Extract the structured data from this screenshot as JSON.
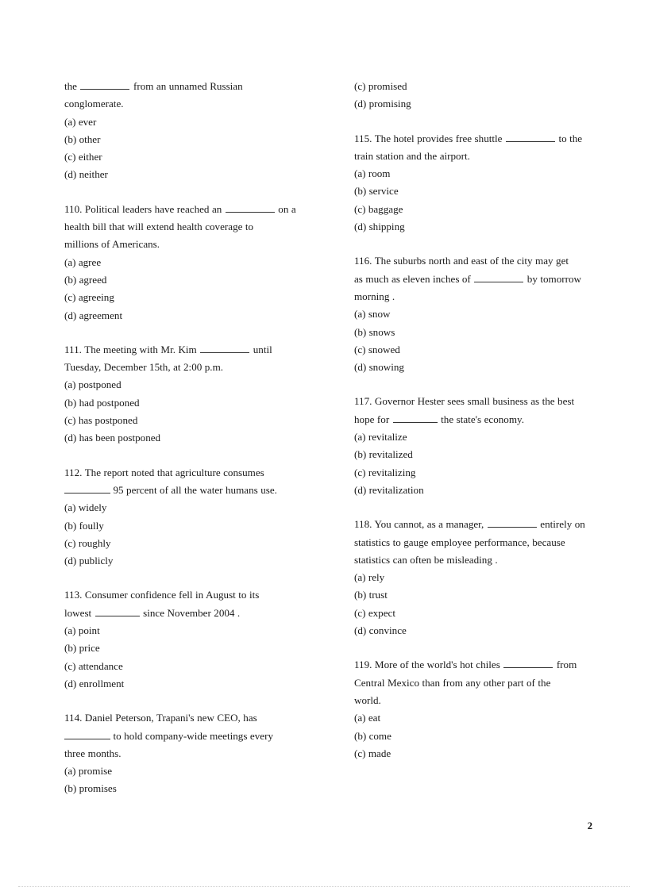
{
  "document": {
    "page_number": "2",
    "type": "multiple-choice grammar test",
    "columns": 2
  },
  "left_column": {
    "questions": [
      {
        "number": "",
        "stem_parts": {
          "before": "the",
          "blank": true,
          "after": "from an unnamed Russian conglomerate."
        },
        "stem_line1": "the",
        "stem_line1_tail": "from    an    unnamed    Russian",
        "stem_line2": "conglomerate.",
        "options": [
          {
            "label": "(a)",
            "text": "ever"
          },
          {
            "label": "(b)",
            "text": "other"
          },
          {
            "label": "(c)",
            "text": "either"
          },
          {
            "label": "(d)",
            "text": "neither"
          }
        ]
      },
      {
        "number": "110.",
        "stem_line1": "Political  leaders have reached an",
        "stem_line1_tail": "on a",
        "stem_line2": "health   bill   that   will   extend  health  coverage  to",
        "stem_line3": "millions  of Americans.",
        "options": [
          {
            "label": "(a)",
            "text": "agree"
          },
          {
            "label": "(b)",
            "text": "agreed"
          },
          {
            "label": "(c)",
            "text": "agreeing"
          },
          {
            "label": "(d)",
            "text": "agreement"
          }
        ]
      },
      {
        "number": "111.",
        "stem_line1": "The   meeting   with   Mr.   Kim",
        "stem_line1_tail": "until",
        "stem_line2": "Tuesday, December 15th, at 2:00 p.m.",
        "options": [
          {
            "label": "(a)",
            "text": "postponed"
          },
          {
            "label": "(b)",
            "text": "had postponed"
          },
          {
            "label": "(c)",
            "text": "has postponed"
          },
          {
            "label": "(d)",
            "text": "has been postponed"
          }
        ]
      },
      {
        "number": "112.",
        "stem_line1": "The   report   noted   that   agriculture   consumes",
        "stem_line2_tail": "95 percent of all the water humans use.",
        "options": [
          {
            "label": "(a)",
            "text": "widely"
          },
          {
            "label": "(b)",
            "text": "foully"
          },
          {
            "label": "(c)",
            "text": "roughly"
          },
          {
            "label": "(d)",
            "text": "publicly"
          }
        ]
      },
      {
        "number": "113.",
        "stem_line1": "Consumer   confidence   fell   in   August   to   its",
        "stem_line2_head": "lowest",
        "stem_line2_tail": "since November 2004 .",
        "options": [
          {
            "label": "(a)",
            "text": "point"
          },
          {
            "label": "(b)",
            "text": "price"
          },
          {
            "label": "(c)",
            "text": "attendance"
          },
          {
            "label": "(d)",
            "text": "enrollment"
          }
        ]
      },
      {
        "number": "114.",
        "stem_line1": "Daniel   Peterson,   Trapani's   new   CEO,   has",
        "stem_line2_tail": "to   hold   company-wide   meetings   every",
        "stem_line3": "three months.",
        "options": [
          {
            "label": "(a)",
            "text": "promise"
          },
          {
            "label": "(b)",
            "text": "promises"
          }
        ]
      }
    ]
  },
  "right_column": {
    "continued_options": [
      {
        "label": "(c)",
        "text": "promised"
      },
      {
        "label": "(d)",
        "text": "promising"
      }
    ],
    "questions": [
      {
        "number": "115.",
        "stem_line1": "The  hotel  provides  free shuttle",
        "stem_line1_tail": "to  the",
        "stem_line2": "train station and the airport.",
        "options": [
          {
            "label": "(a)",
            "text": "room"
          },
          {
            "label": "(b)",
            "text": "service"
          },
          {
            "label": "(c)",
            "text": "baggage"
          },
          {
            "label": "(d)",
            "text": "shipping"
          }
        ]
      },
      {
        "number": "116.",
        "stem_line1": "The suburbs north and east of the city may get",
        "stem_line2_head": "as  much  as  eleven  inches  of",
        "stem_line2_tail": "by  tomorrow",
        "stem_line3": "morning .",
        "options": [
          {
            "label": "(a)",
            "text": "snow"
          },
          {
            "label": "(b)",
            "text": "snows"
          },
          {
            "label": "(c)",
            "text": "snowed"
          },
          {
            "label": "(d)",
            "text": "snowing"
          }
        ]
      },
      {
        "number": "117.",
        "stem_line1": "Governor Hester sees small business as the best",
        "stem_line2_head": "hope for",
        "stem_line2_tail": "the state's economy.",
        "options": [
          {
            "label": "(a)",
            "text": "revitalize"
          },
          {
            "label": "(b)",
            "text": "revitalized"
          },
          {
            "label": "(c)",
            "text": "revitalizing"
          },
          {
            "label": "(d)",
            "text": "revitalization"
          }
        ]
      },
      {
        "number": "118.",
        "stem_line1": "You cannot, as a manager,",
        "stem_line1_tail": "entirely  on",
        "stem_line2": "statistics  to  gauge  employee  performance,  because",
        "stem_line3": "statistics can often be misleading .",
        "options": [
          {
            "label": "(a)",
            "text": "rely"
          },
          {
            "label": "(b)",
            "text": "trust"
          },
          {
            "label": "(c)",
            "text": "expect"
          },
          {
            "label": "(d)",
            "text": "convince"
          }
        ]
      },
      {
        "number": "119.",
        "stem_line1": "More  of  the  world's  hot  chiles",
        "stem_line1_tail": "from",
        "stem_line2": "Central  Mexico  than  from  any  other  part  of  the",
        "stem_line3": "world.",
        "options": [
          {
            "label": "(a)",
            "text": "eat"
          },
          {
            "label": "(b)",
            "text": "come"
          },
          {
            "label": "(c)",
            "text": "made"
          }
        ]
      }
    ]
  }
}
